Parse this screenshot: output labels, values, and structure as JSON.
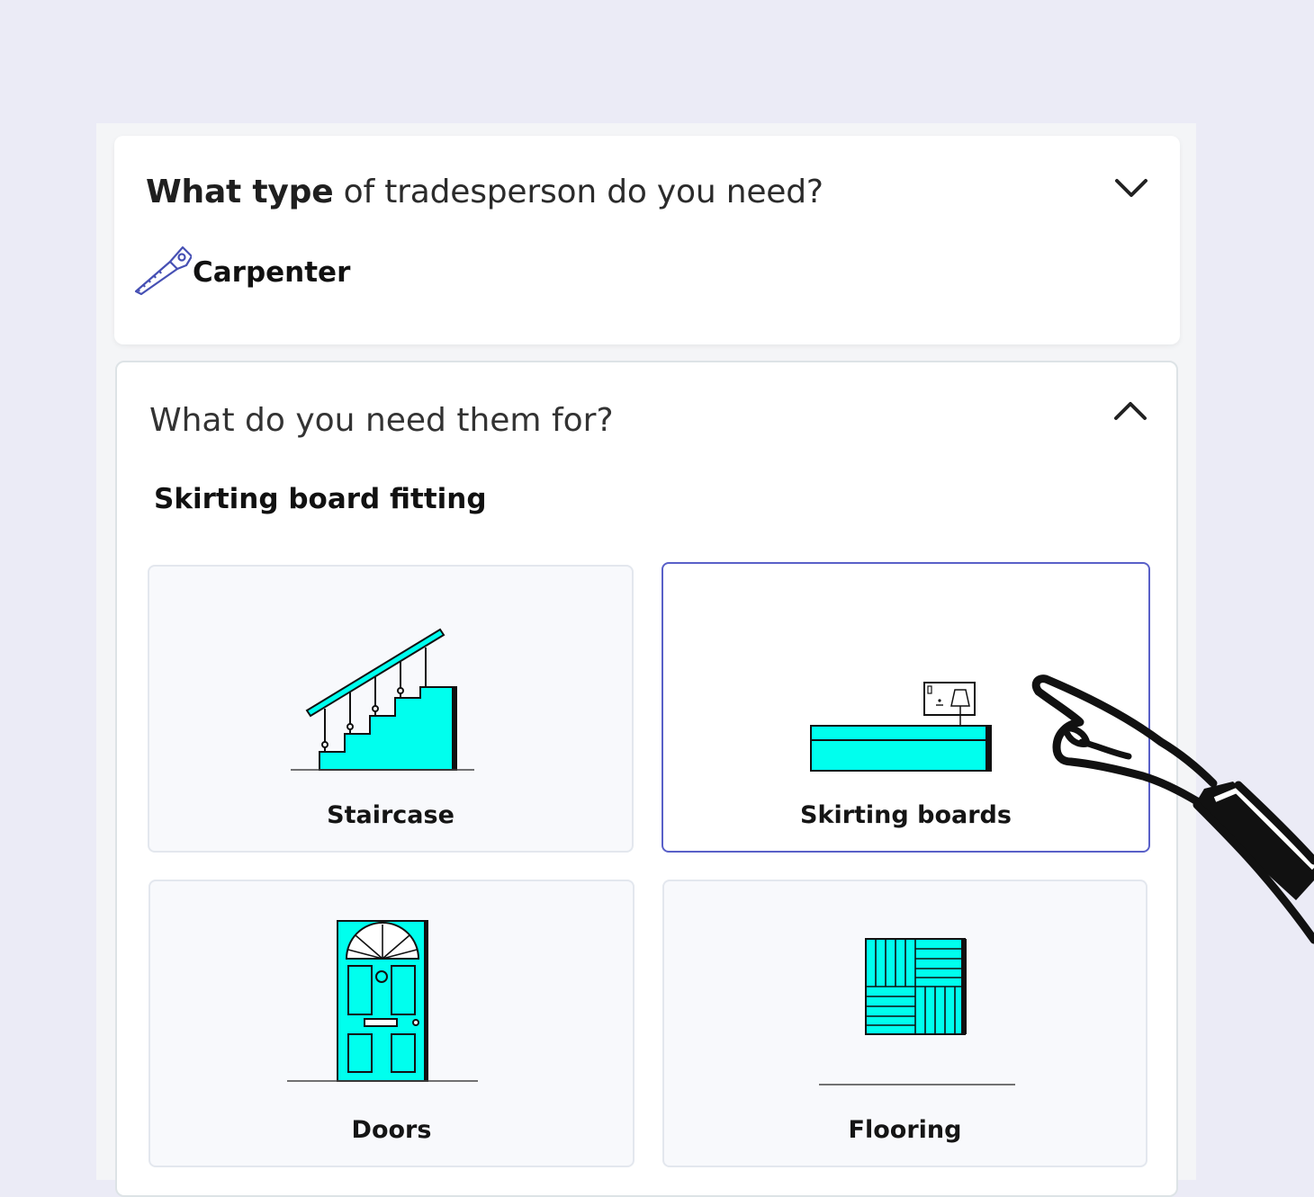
{
  "question1": {
    "bold": "What type",
    "rest": " of tradesperson do you need?",
    "answer": "Carpenter",
    "answer_icon": "saw-icon",
    "toggle_icon": "chevron-down-icon"
  },
  "question2": {
    "text": "What do you need them for?",
    "subtitle": "Skirting board fitting",
    "toggle_icon": "chevron-up-icon"
  },
  "options": [
    {
      "label": "Staircase",
      "icon": "staircase-icon",
      "selected": false
    },
    {
      "label": "Skirting boards",
      "icon": "skirting-board-icon",
      "selected": true
    },
    {
      "label": "Doors",
      "icon": "door-icon",
      "selected": false
    },
    {
      "label": "Flooring",
      "icon": "flooring-icon",
      "selected": false
    }
  ],
  "colors": {
    "background": "#ebebf6",
    "accent": "#5960c8",
    "illustration_fill": "#00ffee",
    "outline": "#111111"
  }
}
